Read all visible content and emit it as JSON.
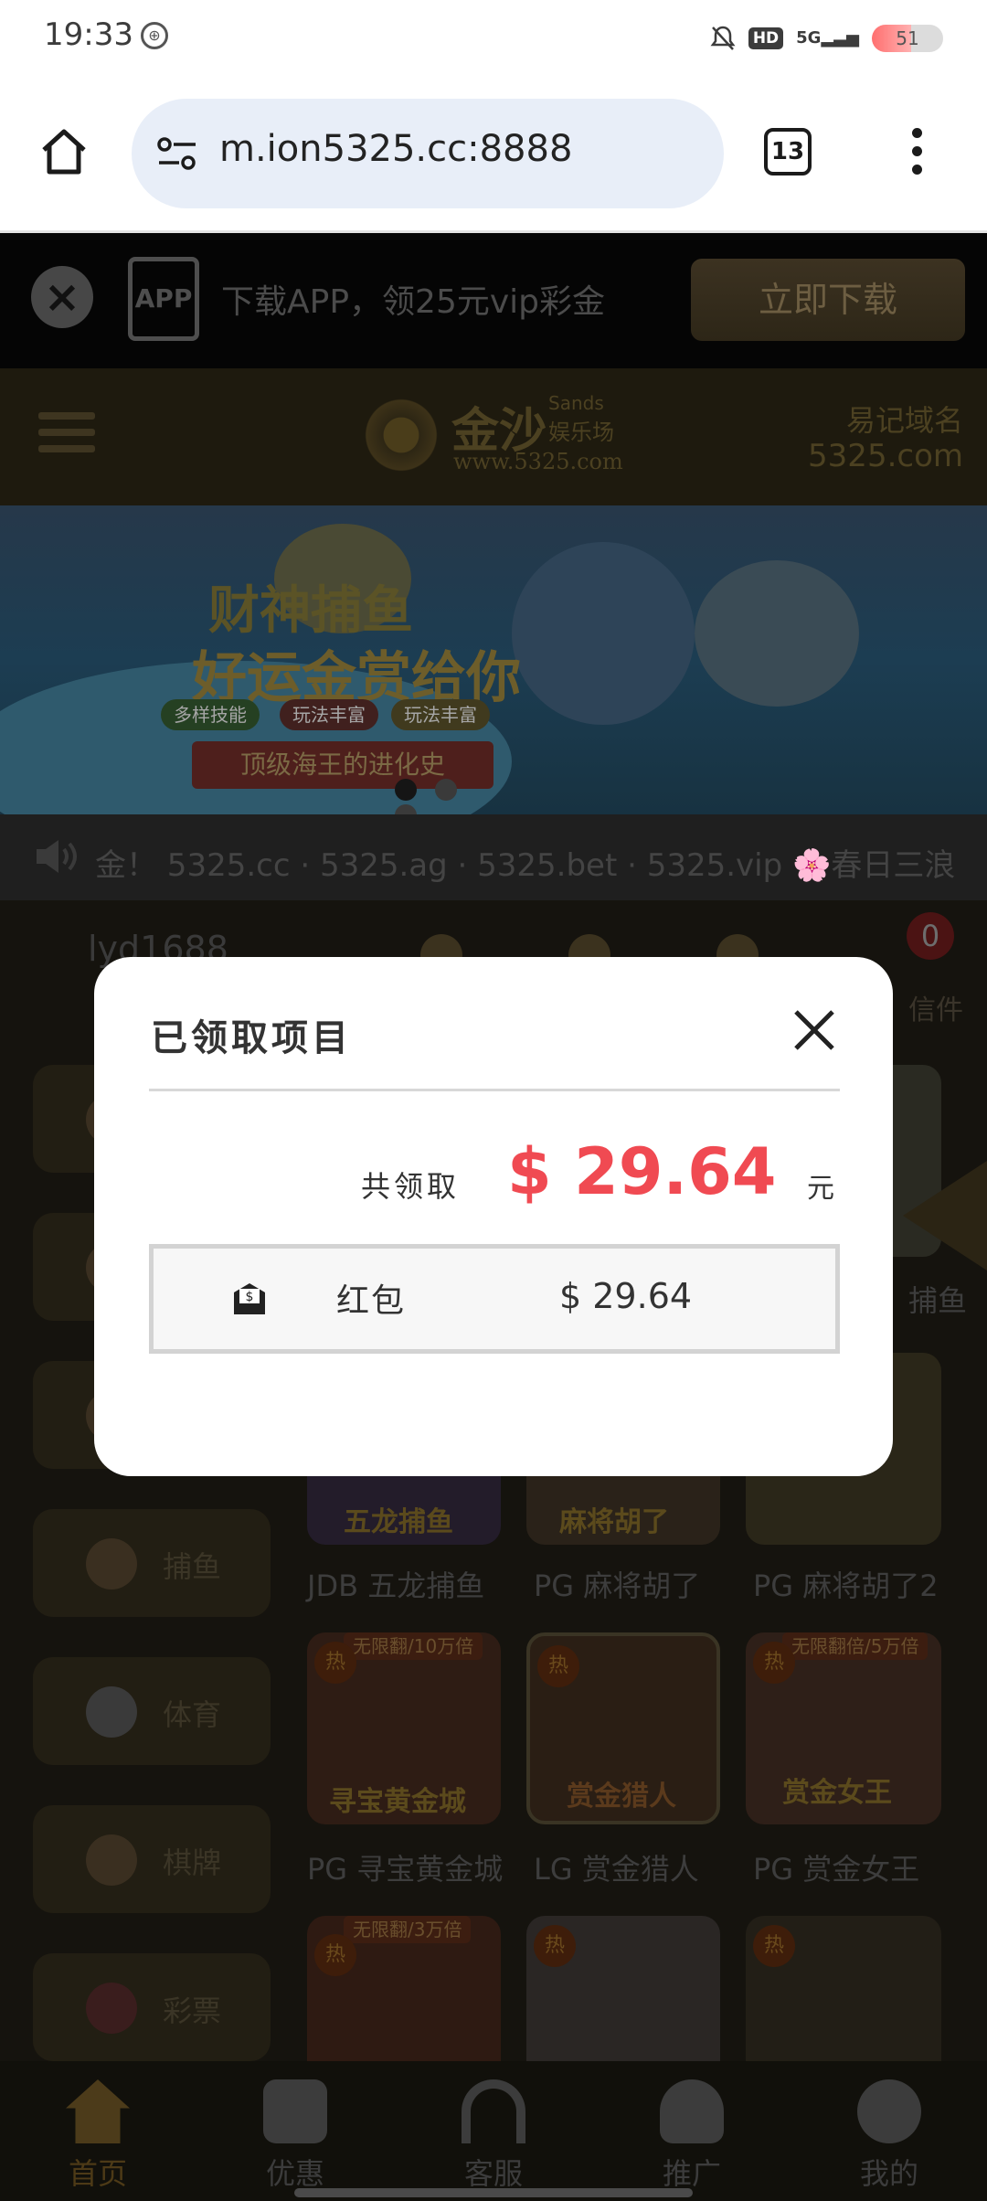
{
  "status_bar": {
    "time": "19:33",
    "network": "5G",
    "hd_badge": "HD",
    "battery": "51"
  },
  "browser": {
    "url": "m.ion5325.cc:8888",
    "tab_count": "13"
  },
  "download_banner": {
    "app_icon_text": "APP",
    "text": "下载APP，领25元vip彩金",
    "button": "立即下载"
  },
  "site_header": {
    "logo_main": "金沙",
    "logo_sub_en": "Sands",
    "logo_sub_cn": "娱乐场",
    "logo_url": "www.5325.com",
    "easy_label": "易记域名",
    "easy_domain": "5325.com"
  },
  "promo": {
    "title_line1": "财神捕鱼",
    "title_line2": "好运金赏给你",
    "pills": [
      "多样技能",
      "玩法丰富",
      "玩法丰富"
    ],
    "ribbon": "顶级海王的进化史"
  },
  "marquee": {
    "text": "金！  5325.cc · 5325.ag · 5325.bet · 5325.vip  🌸春日三浪"
  },
  "account": {
    "username": "lyd1688",
    "mail_badge": "0",
    "mail_label": "信件"
  },
  "categories": [
    {
      "label": "捕鱼"
    },
    {
      "label": "体育"
    },
    {
      "label": "棋牌"
    },
    {
      "label": "彩票"
    }
  ],
  "games": {
    "partial_right_label": "捕鱼",
    "row1": [
      {
        "label": "JDB 五龙捕鱼",
        "art_text": "五龙捕鱼"
      },
      {
        "label": "PG 麻将胡了",
        "art_text": "麻将胡了"
      },
      {
        "label": "PG 麻将胡了2",
        "art_text": ""
      }
    ],
    "row2": [
      {
        "label": "PG 寻宝黄金城",
        "tag": "无限翻/10万倍",
        "art_text": "寻宝黄金城"
      },
      {
        "label": "LG 赏金猎人",
        "tag": "",
        "art_text": "赏金猎人"
      },
      {
        "label": "PG 赏金女王",
        "tag": "无限翻倍/5万倍",
        "art_text": "赏金女王"
      }
    ],
    "row3": [
      {
        "tag": "无限翻/3万倍"
      },
      {
        "tag": ""
      },
      {
        "tag": ""
      }
    ],
    "hot_badge": "热"
  },
  "bottom_nav": [
    {
      "label": "首页",
      "icon": "home-icon"
    },
    {
      "label": "优惠",
      "icon": "gift-icon"
    },
    {
      "label": "客服",
      "icon": "headset-icon"
    },
    {
      "label": "推广",
      "icon": "add-user-icon"
    },
    {
      "label": "我的",
      "icon": "profile-icon"
    }
  ],
  "modal": {
    "title": "已领取项目",
    "total_label": "共领取",
    "total_amount": "$ 29.64",
    "unit": "元",
    "items": [
      {
        "icon": "red-envelope-icon",
        "label": "红包",
        "amount": "$ 29.64"
      }
    ]
  },
  "colors": {
    "accent_red": "#f04a52",
    "gold": "#c8a24e",
    "overlay": "rgba(0,0,0,0.55)"
  }
}
